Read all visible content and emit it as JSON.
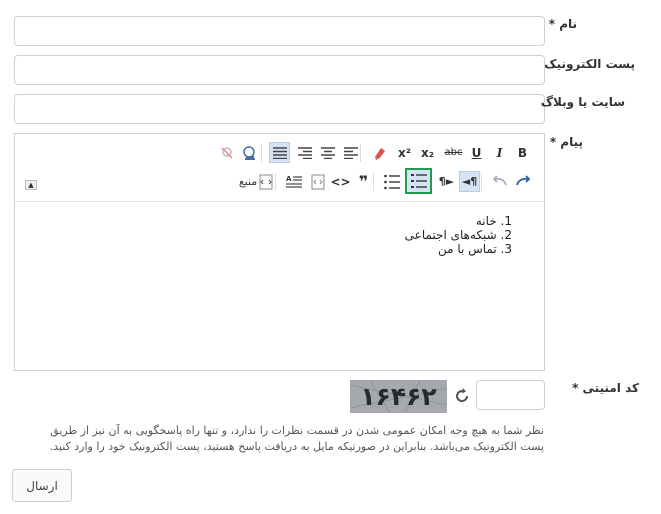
{
  "form": {
    "name_label": "نام",
    "email_label": "پست الکترونیک",
    "website_label": "سایت یا وبلاگ",
    "message_label": "پیام",
    "captcha_label": "کد امنیتی",
    "required_mark": "*",
    "captcha_code": "۱۶۴۶۲",
    "note": "نظر شما به هیچ وجه امکان عمومی شدن در قسمت نظرات را ندارد، و تنها راه پاسخگویی به آن نیز از طریق پست الکترونیک می‌باشد. بنابراین در صورتیکه مایل به دریافت پاسخ هستید، پست الکترونیک خود را وارد کنید.",
    "submit_label": "ارسال"
  },
  "editor": {
    "toolbar": {
      "bold": "B",
      "italic": "I",
      "underline": "U",
      "strike": "abc",
      "subscript": "x₂",
      "superscript": "x²",
      "source_label": "منبع"
    },
    "list_items": [
      "1. خانه",
      "2. شبکه‌های اجتماعی",
      "3. تماس با من"
    ]
  },
  "colors": {
    "highlight_border": "#1f9d4a",
    "active_bg": "#d6e3f5",
    "border": "#d0d0d0"
  }
}
